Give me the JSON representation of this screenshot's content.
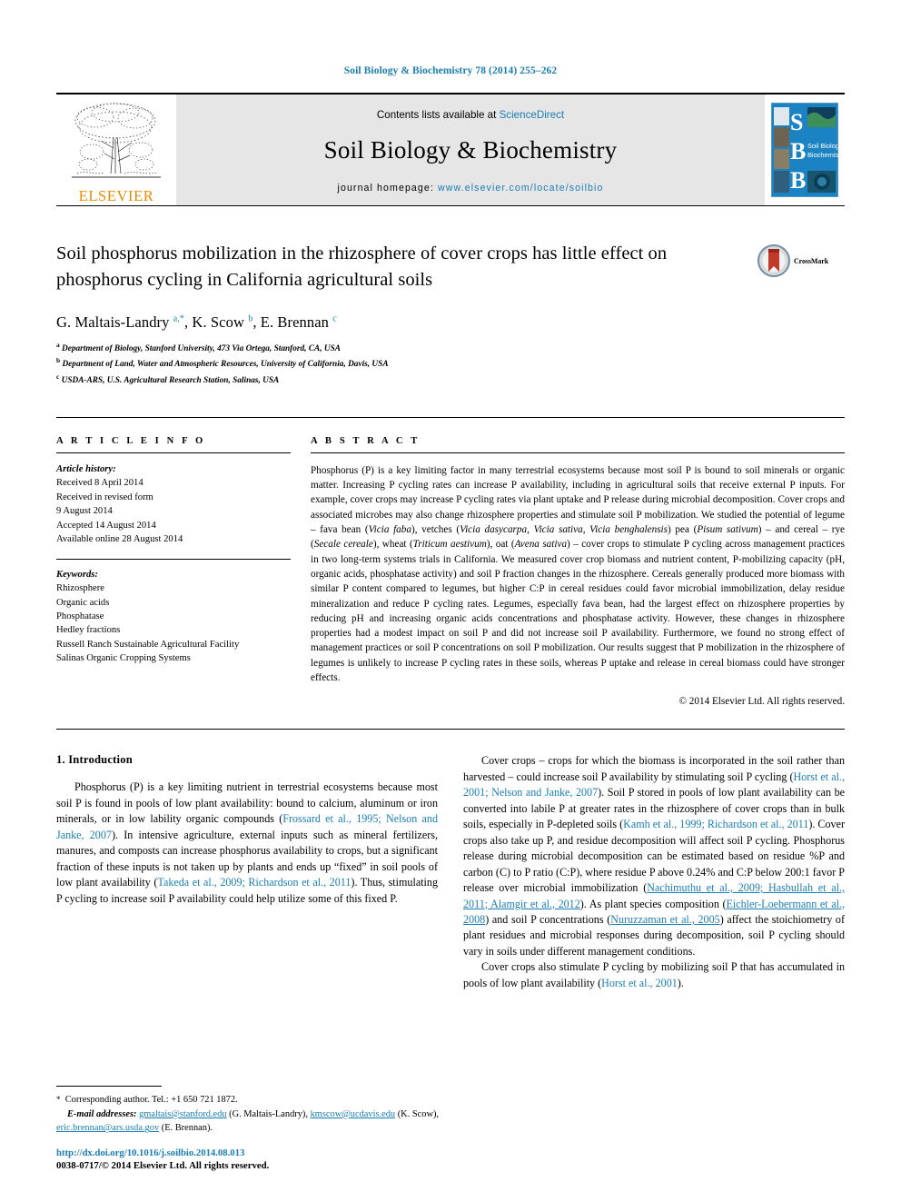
{
  "running_head": "Soil Biology & Biochemistry 78 (2014) 255–262",
  "masthead": {
    "publisher_name": "ELSEVIER",
    "contents_prefix": "Contents lists available at",
    "contents_link": "ScienceDirect",
    "journal_name": "Soil Biology & Biochemistry",
    "homepage_prefix": "journal homepage:",
    "homepage_url": "www.elsevier.com/locate/soilbio",
    "cover_letters": [
      "S",
      "B",
      "B"
    ],
    "cover_title_line1": "Soil Biology &",
    "cover_title_line2": "Biochemistry",
    "link_color": "#1a7eb5",
    "band_color": "#e6e6e6",
    "elsevier_orange": "#ED8B00"
  },
  "article": {
    "title": "Soil phosphorus mobilization in the rhizosphere of cover crops has little effect on phosphorus cycling in California agricultural soils",
    "crossmark_label": "CrossMark",
    "authors_html": "G. Maltais-Landry <sup>a,</sup><sup class=\"star\">*</sup>, K. Scow <sup>b</sup>, E. Brennan <sup>c</sup>",
    "affiliations": [
      {
        "marker": "a",
        "text": "Department of Biology, Stanford University, 473 Via Ortega, Stanford, CA, USA"
      },
      {
        "marker": "b",
        "text": "Department of Land, Water and Atmospheric Resources, University of California, Davis, USA"
      },
      {
        "marker": "c",
        "text": "USDA-ARS, U.S. Agricultural Research Station, Salinas, USA"
      }
    ]
  },
  "article_info": {
    "heading": "A R T I C L E    I N F O",
    "history_label": "Article history:",
    "history": [
      "Received 8 April 2014",
      "Received in revised form",
      "9 August 2014",
      "Accepted 14 August 2014",
      "Available online 28 August 2014"
    ],
    "keywords_label": "Keywords:",
    "keywords": [
      "Rhizosphere",
      "Organic acids",
      "Phosphatase",
      "Hedley fractions",
      "Russell Ranch Sustainable Agricultural Facility",
      "Salinas Organic Cropping Systems"
    ]
  },
  "abstract": {
    "heading": "A B S T R A C T",
    "text_html": "Phosphorus (P) is a key limiting factor in many terrestrial ecosystems because most soil P is bound to soil minerals or organic matter. Increasing P cycling rates can increase P availability, including in agricultural soils that receive external P inputs. For example, cover crops may increase P cycling rates via plant uptake and P release during microbial decomposition. Cover crops and associated microbes may also change rhizosphere properties and stimulate soil P mobilization. We studied the potential of legume &ndash; fava bean (<i>Vicia faba</i>), vetches (<i>Vicia dasycarpa</i>, <i>Vicia sativa</i>, <i>Vicia benghalensis</i>) pea (<i>Pisum sativum</i>) &ndash; and cereal &ndash; rye (<i>Secale cereale</i>), wheat (<i>Triticum aestivum</i>), oat (<i>Avena sativa</i>) &ndash; cover crops to stimulate P cycling across management practices in two long-term systems trials in California. We measured cover crop biomass and nutrient content, P-mobilizing capacity (pH, organic acids, phosphatase activity) and soil P fraction changes in the rhizosphere. Cereals generally produced more biomass with similar P content compared to legumes, but higher C:P in cereal residues could favor microbial immobilization, delay residue mineralization and reduce P cycling rates. Legumes, especially fava bean, had the largest effect on rhizosphere properties by reducing pH and increasing organic acids concentrations and phosphatase activity. However, these changes in rhizosphere properties had a modest impact on soil P and did not increase soil P availability. Furthermore, we found no strong effect of management practices or soil P concentrations on soil P mobilization. Our results suggest that P mobilization in the rhizosphere of legumes is unlikely to increase P cycling rates in these soils, whereas P uptake and release in cereal biomass could have stronger effects.",
    "copyright": "© 2014 Elsevier Ltd. All rights reserved."
  },
  "introduction": {
    "heading": "1. Introduction",
    "left_paragraphs_html": [
      "Phosphorus (P) is a key limiting nutrient in terrestrial ecosystems because most soil P is found in pools of low plant availability: bound to calcium, aluminum or iron minerals, or in low lability organic compounds (<span class=\"cite\">Frossard et al., 1995; Nelson and Janke, 2007</span>). In intensive agriculture, external inputs such as mineral fertilizers, manures, and composts can increase phosphorus availability to crops, but a significant fraction of these inputs is not taken up by plants and ends up &ldquo;fixed&rdquo; in soil pools of low plant availability (<span class=\"cite\">Takeda et al., 2009; Richardson et al., 2011</span>). Thus, stimulating P cycling to increase soil P availability could help utilize some of this fixed P."
    ],
    "right_paragraphs_html": [
      "Cover crops &ndash; crops for which the biomass is incorporated in the soil rather than harvested &ndash; could increase soil P availability by stimulating soil P cycling (<span class=\"cite\">Horst et al., 2001; Nelson and Janke, 2007</span>). Soil P stored in pools of low plant availability can be converted into labile P at greater rates in the rhizosphere of cover crops than in bulk soils, especially in P-depleted soils (<span class=\"cite\">Kamh et al., 1999; Richardson et al., 2011</span>). Cover crops also take up P, and residue decomposition will affect soil P cycling. Phosphorus release during microbial decomposition can be estimated based on residue %P and carbon (C) to P ratio (C:P), where residue P above 0.24% and C:P below 200:1 favor P release over microbial immobilization (<span class=\"cite ul\">Nachimuthu et al., 2009; Hasbullah et al., 2011; Alamgir et al., 2012</span>). As plant species composition (<span class=\"cite ul\">Eichler-Loebermann et al., 2008</span>) and soil P concentrations (<span class=\"cite ul\">Nuruzzaman et al., 2005</span>) affect the stoichiometry of plant residues and microbial responses during decomposition, soil P cycling should vary in soils under different management conditions.",
      "Cover crops also stimulate P cycling by mobilizing soil P that has accumulated in pools of low plant availability (<span class=\"cite\">Horst et al., 2001</span>)."
    ]
  },
  "footnote": {
    "corresponding_html": "<span class=\"star\">*</span>&nbsp; Corresponding author. Tel.: +1 650 721 1872.",
    "email_html": "<span class=\"lead\">E-mail addresses:</span> <span class=\"cite ul\">gmaltais@stanford.edu</span> (G. Maltais-Landry), <span class=\"cite ul\">kmscow@ucdavis.edu</span> (K. Scow), <span class=\"cite ul\">eric.brennan@ars.usda.gov</span> (E. Brennan).",
    "doi": "http://dx.doi.org/10.1016/j.soilbio.2014.08.013",
    "issn_line": "0038-0717/© 2014 Elsevier Ltd. All rights reserved."
  }
}
